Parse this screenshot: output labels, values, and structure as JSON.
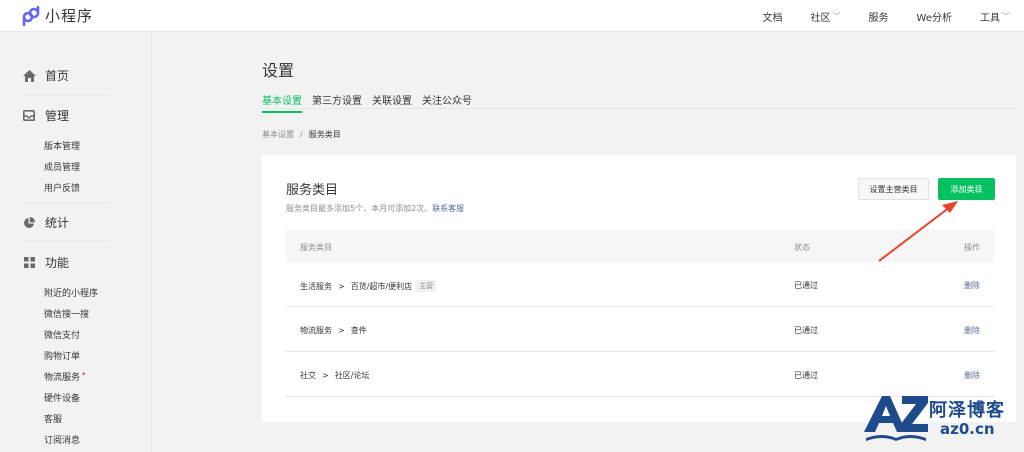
{
  "header": {
    "app_name": "小程序",
    "nav": [
      {
        "label": "文档",
        "dropdown": false
      },
      {
        "label": "社区",
        "dropdown": true
      },
      {
        "label": "服务",
        "dropdown": false
      },
      {
        "label": "We分析",
        "dropdown": false
      },
      {
        "label": "工具",
        "dropdown": true
      }
    ]
  },
  "sidebar": {
    "home": "首页",
    "manage": {
      "label": "管理",
      "items": [
        "版本管理",
        "成员管理",
        "用户反馈"
      ]
    },
    "stats": "统计",
    "features": {
      "label": "功能",
      "items": [
        "附近的小程序",
        "微信搜一搜",
        "微信支付",
        "购物订单",
        "物流服务",
        "硬件设备",
        "客服",
        "订阅消息"
      ]
    }
  },
  "main": {
    "title": "设置",
    "tabs": [
      "基本设置",
      "第三方设置",
      "关联设置",
      "关注公众号"
    ],
    "active_tab": 0,
    "breadcrumb": {
      "parent": "基本设置",
      "sep": "/",
      "current": "服务类目"
    },
    "card": {
      "title": "服务类目",
      "desc": "服务类目最多添加5个，本月可添加2次。",
      "desc_link": "联系客服",
      "btn_set_primary": "设置主营类目",
      "btn_add": "添加类目",
      "columns": [
        "服务类目",
        "状态",
        "操作"
      ],
      "rows": [
        {
          "cat": "生活服务",
          "sub": "百货/超市/便利店",
          "tag": "主营",
          "status": "已通过",
          "action": "删除"
        },
        {
          "cat": "物流服务",
          "sub": "查件",
          "tag": "",
          "status": "已通过",
          "action": "删除"
        },
        {
          "cat": "社交",
          "sub": "社区/论坛",
          "tag": "",
          "status": "已通过",
          "action": "删除"
        }
      ],
      "gt": ">"
    }
  },
  "watermark": {
    "letters": "AZ",
    "cn": "阿泽博客",
    "en": "az0.cn"
  },
  "colors": {
    "accent": "#07c160",
    "link": "#576b95",
    "arrow": "#e8412c",
    "watermark": "#1d4b8c"
  }
}
